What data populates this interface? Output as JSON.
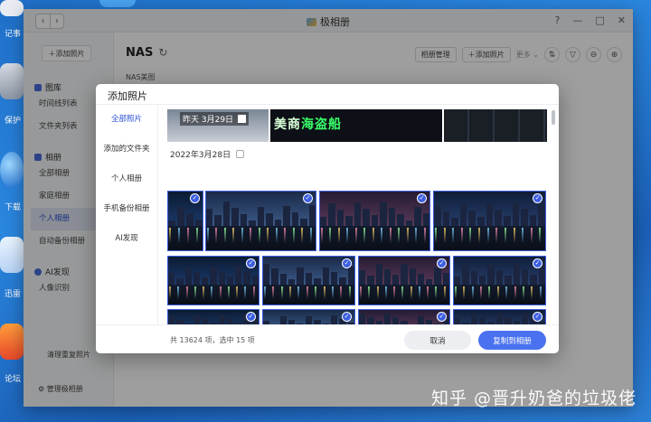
{
  "desktop": {
    "labels": [
      "记事",
      "保护",
      "下载",
      "迅雷",
      "论坛"
    ]
  },
  "window": {
    "title": "极相册",
    "nav_back": "‹",
    "nav_forward": "›",
    "ctrl_help": "?",
    "ctrl_min": "—",
    "ctrl_max": "□",
    "ctrl_close": "✕"
  },
  "sidebar": {
    "add_photo": "＋添加照片",
    "gallery_header": "图库",
    "gallery_items": [
      "时间线列表",
      "文件夹列表"
    ],
    "album_header": "相册",
    "album_items": [
      "全部相册",
      "家庭相册",
      "个人相册",
      "自动备份相册"
    ],
    "ai_header": "AI发现",
    "ai_items": [
      "人像识别"
    ],
    "clean_dupes": "清理重复照片",
    "manage": "管理极相册"
  },
  "main": {
    "title": "NAS",
    "subtitle": "NAS美图",
    "toolbar": {
      "album_manage": "相册管理",
      "add_photo": "＋添加照片",
      "more": "更多"
    }
  },
  "modal": {
    "title": "添加照片",
    "nav": [
      "全部照片",
      "添加的文件夹",
      "个人相册",
      "手机备份相册",
      "AI发现"
    ],
    "yesterday_label": "昨天  3月29日",
    "neon_text_a": "美商",
    "neon_text_b": "海盗船",
    "date_group": "2022年3月28日",
    "check_glyph": "✓",
    "footer_count": "共 13624 项，选中 15 项",
    "cancel": "取消",
    "copy": "复制到相册"
  },
  "watermark": "知乎 @晋升奶爸的垃圾佬"
}
